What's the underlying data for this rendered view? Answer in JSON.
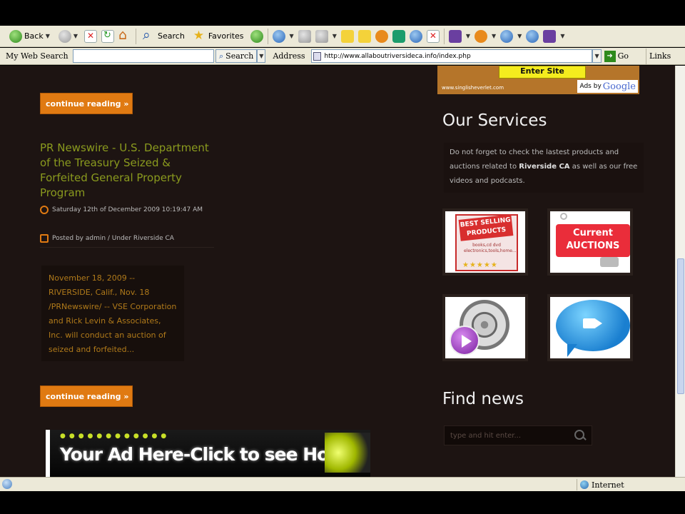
{
  "toolbar": {
    "back_label": "Back",
    "search_label": "Search",
    "favorites_label": "Favorites"
  },
  "addressbar": {
    "mywebsearch_label": "My Web Search",
    "search_button": "Search",
    "address_label": "Address",
    "url": "http://www.allaboutriversideca.info/index.php",
    "go_label": "Go",
    "links_label": "Links"
  },
  "main": {
    "continue_label": "continue reading »",
    "post": {
      "title": "PR Newswire - U.S. Department of the Treasury Seized & Forfeited General Property Program",
      "date": "Saturday 12th of December 2009 10:19:47 AM",
      "byline": "Posted by admin / Under Riverside CA",
      "excerpt": "November 18, 2009 -- RIVERSIDE, Calif., Nov. 18 /PRNewswire/ -- VSE Corporation and Rick Levin & Associates, Inc. will conduct an auction of seized and forfeited..."
    },
    "ad_banner_text": "Your Ad Here-Click to see How"
  },
  "sidebar": {
    "google_ad": {
      "button_text": "Enter Site",
      "url_text": "www.singlisheverlet.com",
      "ads_by": "Ads by",
      "google_word": "Google"
    },
    "services_heading": "Our Services",
    "services_text_1": "Do not forget to check the lastest products and auctions related to",
    "services_bold": "Riverside CA",
    "services_text_2": "as well as our free videos and podcasts.",
    "tiles": {
      "best_selling": "BEST SELLING PRODUCTS",
      "best_selling_small": "books,cd dvd electronics,tools,home...",
      "auctions": "Current AUCTIONS"
    },
    "find_news_heading": "Find news",
    "search_placeholder": "type and hit enter..."
  },
  "statusbar": {
    "zone_label": "Internet"
  }
}
